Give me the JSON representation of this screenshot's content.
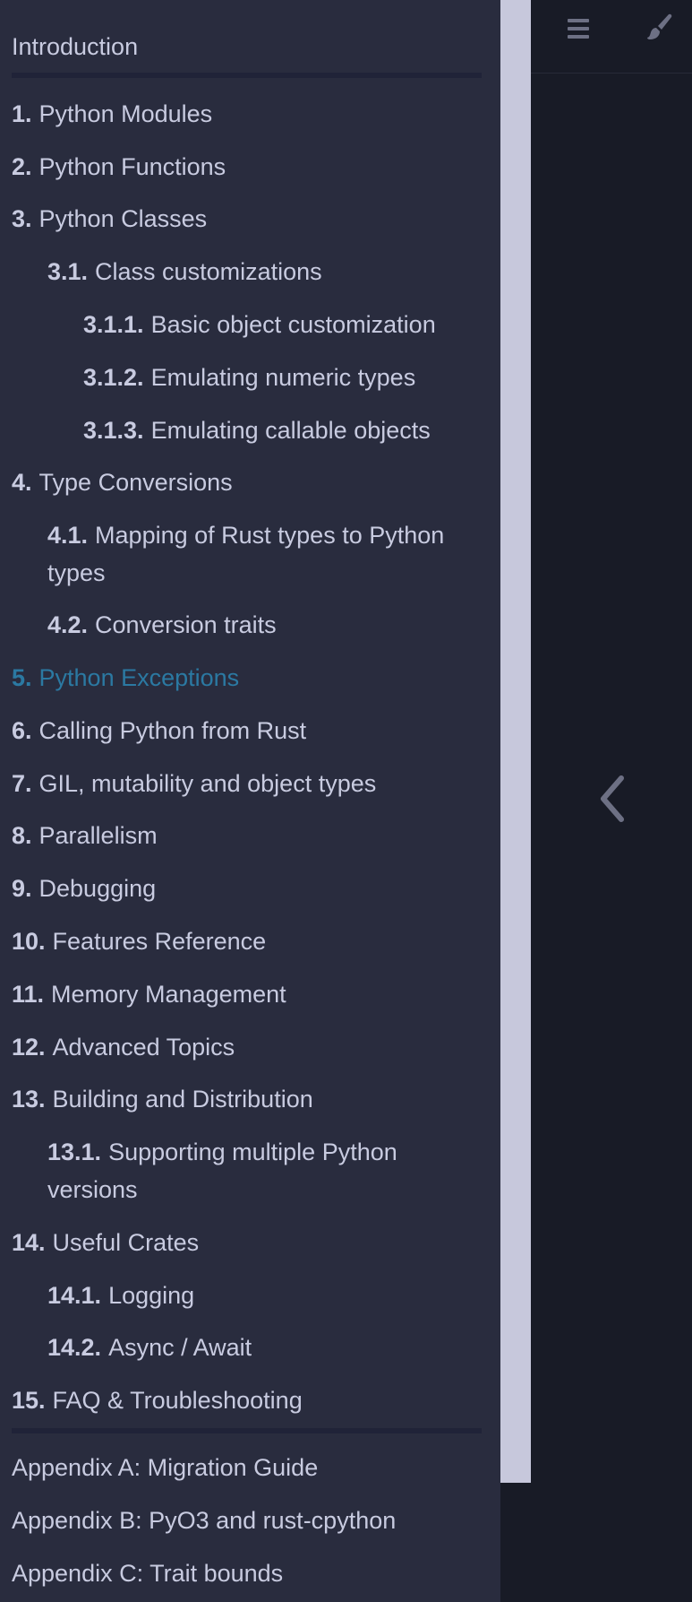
{
  "sidebar": {
    "intro": "Introduction",
    "items": [
      {
        "num": "1.",
        "label": "Python Modules"
      },
      {
        "num": "2.",
        "label": "Python Functions"
      },
      {
        "num": "3.",
        "label": "Python Classes"
      },
      {
        "num": "3.1.",
        "label": "Class customizations"
      },
      {
        "num": "3.1.1.",
        "label": "Basic object customization"
      },
      {
        "num": "3.1.2.",
        "label": "Emulating numeric types"
      },
      {
        "num": "3.1.3.",
        "label": "Emulating callable objects"
      },
      {
        "num": "4.",
        "label": "Type Conversions"
      },
      {
        "num": "4.1.",
        "label": "Mapping of Rust types to Python types"
      },
      {
        "num": "4.2.",
        "label": "Conversion traits"
      },
      {
        "num": "5.",
        "label": "Python Exceptions"
      },
      {
        "num": "6.",
        "label": "Calling Python from Rust"
      },
      {
        "num": "7.",
        "label": "GIL, mutability and object types"
      },
      {
        "num": "8.",
        "label": "Parallelism"
      },
      {
        "num": "9.",
        "label": "Debugging"
      },
      {
        "num": "10.",
        "label": "Features Reference"
      },
      {
        "num": "11.",
        "label": "Memory Management"
      },
      {
        "num": "12.",
        "label": "Advanced Topics"
      },
      {
        "num": "13.",
        "label": "Building and Distribution"
      },
      {
        "num": "13.1.",
        "label": "Supporting multiple Python versions"
      },
      {
        "num": "14.",
        "label": "Useful Crates"
      },
      {
        "num": "14.1.",
        "label": "Logging"
      },
      {
        "num": "14.2.",
        "label": "Async / Await"
      },
      {
        "num": "15.",
        "label": "FAQ & Troubleshooting"
      }
    ],
    "appendices": [
      "Appendix A: Migration Guide",
      "Appendix B: PyO3 and rust-cpython",
      "Appendix C: Trait bounds"
    ],
    "active_index": 10
  },
  "toolbar": {
    "menu_icon": "hamburger-menu-icon",
    "theme_icon": "paintbrush-icon"
  },
  "nav": {
    "prev_icon": "chevron-left-icon"
  },
  "colors": {
    "sidebar_bg": "#292c3e",
    "content_bg": "#181b26",
    "text": "#c8cbe0",
    "active": "#2b79a2",
    "scrollbar": "#c7c8dc"
  }
}
